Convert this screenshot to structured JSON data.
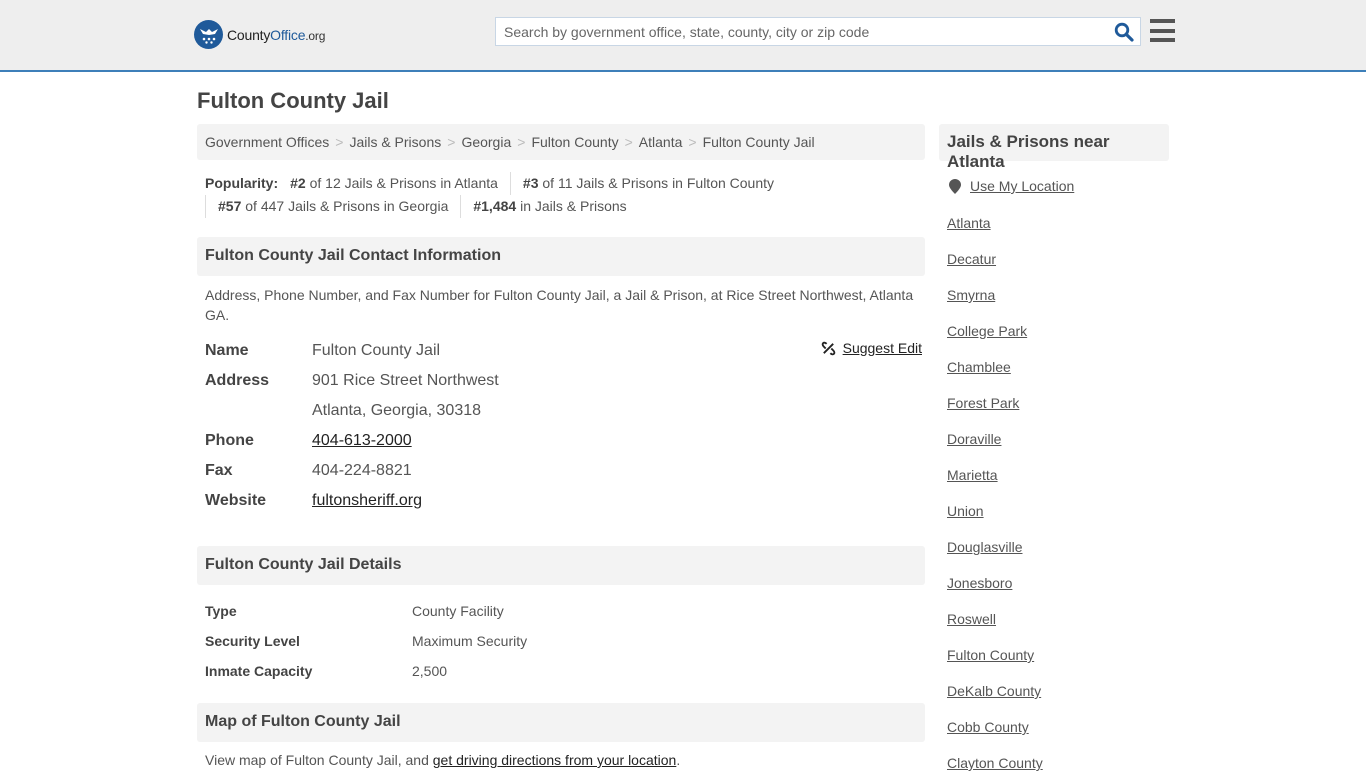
{
  "header": {
    "logo": {
      "brand_county": "County",
      "brand_office": "Office",
      "brand_tld": ".org"
    },
    "search": {
      "placeholder": "Search by government office, state, county, city or zip code",
      "value": ""
    },
    "icons": {
      "search": "search-icon",
      "menu": "hamburger-menu-icon"
    }
  },
  "page": {
    "title": "Fulton County Jail"
  },
  "breadcrumb": [
    "Government Offices",
    "Jails & Prisons",
    "Georgia",
    "Fulton County",
    "Atlanta",
    "Fulton County Jail"
  ],
  "popularity": {
    "label": "Popularity:",
    "items": [
      {
        "rank": "#2",
        "text": " of 12 Jails & Prisons in Atlanta"
      },
      {
        "rank": "#3",
        "text": " of 11 Jails & Prisons in Fulton County"
      },
      {
        "rank": "#57",
        "text": " of 447 Jails & Prisons in Georgia"
      },
      {
        "rank": "#1,484",
        "text": " in Jails & Prisons"
      }
    ]
  },
  "contact": {
    "heading": "Fulton County Jail Contact Information",
    "intro": "Address, Phone Number, and Fax Number for Fulton County Jail, a Jail & Prison, at Rice Street Northwest, Atlanta GA.",
    "suggest_edit": "Suggest Edit",
    "fields": {
      "name_label": "Name",
      "name": "Fulton County Jail",
      "address_label": "Address",
      "address_line1": "901 Rice Street Northwest",
      "address_line2": "Atlanta, Georgia, 30318",
      "phone_label": "Phone",
      "phone": "404-613-2000",
      "fax_label": "Fax",
      "fax": "404-224-8821",
      "website_label": "Website",
      "website": "fultonsheriff.org"
    }
  },
  "details": {
    "heading": "Fulton County Jail Details",
    "rows": [
      {
        "label": "Type",
        "value": "County Facility"
      },
      {
        "label": "Security Level",
        "value": "Maximum Security"
      },
      {
        "label": "Inmate Capacity",
        "value": "2,500"
      }
    ]
  },
  "map": {
    "heading": "Map of Fulton County Jail",
    "text_before": "View map of Fulton County Jail, and ",
    "link": "get driving directions from your location",
    "text_after": "."
  },
  "sidebar": {
    "heading": "Jails & Prisons near Atlanta",
    "use_location": "Use My Location",
    "places": [
      "Atlanta",
      "Decatur",
      "Smyrna",
      "College Park",
      "Chamblee",
      "Forest Park",
      "Doraville",
      "Marietta",
      "Union",
      "Douglasville",
      "Jonesboro",
      "Roswell",
      "Fulton County",
      "DeKalb County",
      "Cobb County",
      "Clayton County"
    ]
  },
  "colors": {
    "accent": "#3d7fb9",
    "brand": "#1f5a9a",
    "header_bg": "#eeeeee",
    "panel_bg": "#f3f3f3"
  }
}
